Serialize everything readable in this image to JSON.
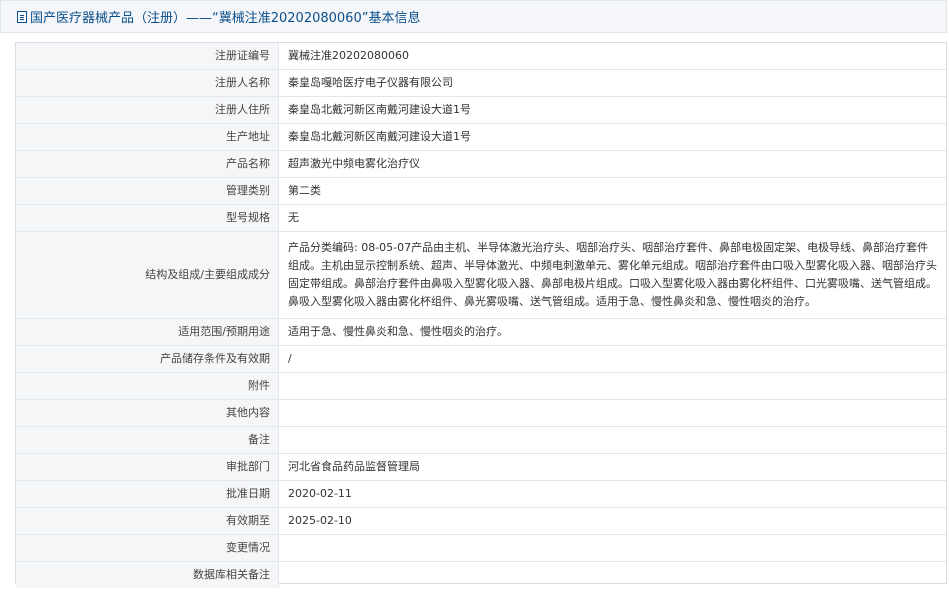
{
  "header": {
    "title": "国产医疗器械产品（注册）——“冀械注准20202080060”基本信息"
  },
  "rows": [
    {
      "label": "注册证编号",
      "value": "冀械注准20202080060"
    },
    {
      "label": "注册人名称",
      "value": "秦皇岛嘎哈医疗电子仪器有限公司"
    },
    {
      "label": "注册人住所",
      "value": "秦皇岛北戴河新区南戴河建设大道1号"
    },
    {
      "label": "生产地址",
      "value": "秦皇岛北戴河新区南戴河建设大道1号"
    },
    {
      "label": "产品名称",
      "value": "超声激光中频电雾化治疗仪"
    },
    {
      "label": "管理类别",
      "value": "第二类"
    },
    {
      "label": "型号规格",
      "value": "无"
    },
    {
      "label": "结构及组成/主要组成成分",
      "value": "产品分类编码: 08-05-07产品由主机、半导体激光治疗头、咽部治疗头、咽部治疗套件、鼻部电极固定架、电极导线、鼻部治疗套件组成。主机由显示控制系统、超声、半导体激光、中频电刺激单元、雾化单元组成。咽部治疗套件由口吸入型雾化吸入器、咽部治疗头固定带组成。鼻部治疗套件由鼻吸入型雾化吸入器、鼻部电极片组成。口吸入型雾化吸入器由雾化杯组件、口光雾吸嘴、送气管组成。鼻吸入型雾化吸入器由雾化杯组件、鼻光雾吸嘴、送气管组成。适用于急、慢性鼻炎和急、慢性咽炎的治疗。"
    },
    {
      "label": "适用范围/预期用途",
      "value": "适用于急、慢性鼻炎和急、慢性咽炎的治疗。"
    },
    {
      "label": "产品储存条件及有效期",
      "value": "/"
    },
    {
      "label": "附件",
      "value": ""
    },
    {
      "label": "其他内容",
      "value": ""
    },
    {
      "label": "备注",
      "value": ""
    },
    {
      "label": "审批部门",
      "value": "河北省食品药品监督管理局"
    },
    {
      "label": "批准日期",
      "value": "2020-02-11"
    },
    {
      "label": "有效期至",
      "value": "2025-02-10"
    },
    {
      "label": "变更情况",
      "value": ""
    },
    {
      "label": "数据库相关备注",
      "value": ""
    }
  ]
}
